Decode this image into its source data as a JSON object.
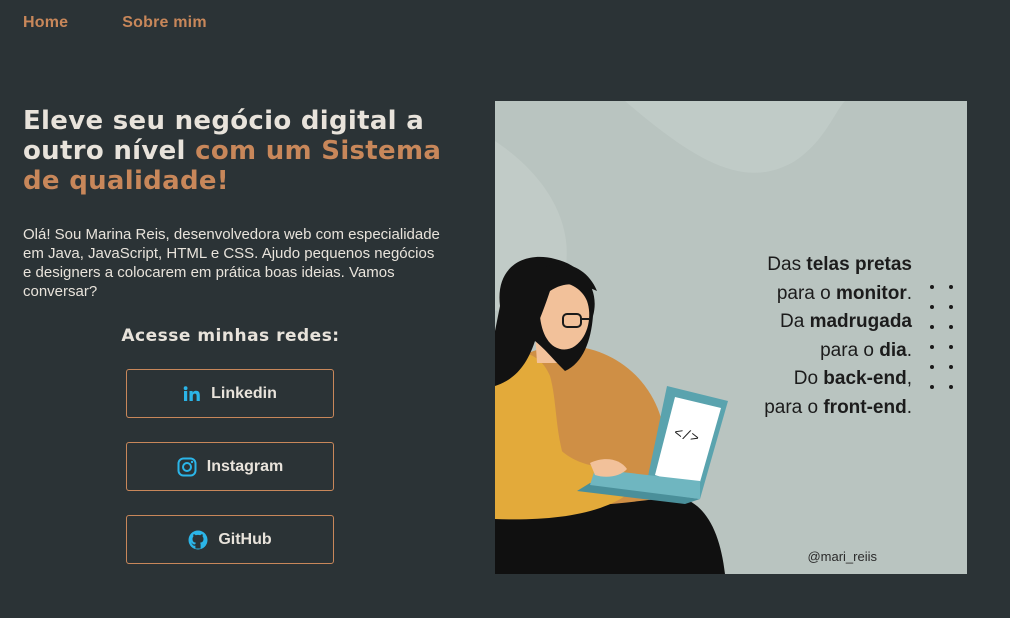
{
  "nav": {
    "home": "Home",
    "about": "Sobre mim"
  },
  "hero": {
    "title_part1": "Eleve seu negócio digital a outro nível",
    "title_part2": "com um Sistema de qualidade!",
    "intro": "Olá! Sou Marina Reis, desenvolvedora web com especialidade em Java, JavaScript, HTML e CSS. Ajudo pequenos negócios e designers a colocarem em prática boas ideias. Vamos conversar?"
  },
  "social": {
    "title": "Acesse minhas redes:",
    "linkedin": "Linkedin",
    "instagram": "Instagram",
    "github": "GitHub"
  },
  "illustration": {
    "lines": [
      {
        "pre": "Das ",
        "bold": "telas pretas",
        "post": ""
      },
      {
        "pre": "para o ",
        "bold": "monitor",
        "post": "."
      },
      {
        "pre": "Da ",
        "bold": "madrugada",
        "post": ""
      },
      {
        "pre": "para o ",
        "bold": "dia",
        "post": "."
      },
      {
        "pre": "Do ",
        "bold": "back-end",
        "post": ","
      },
      {
        "pre": "para o ",
        "bold": "front-end",
        "post": "."
      }
    ],
    "handle": "@mari_reiis",
    "code_glyph": "</>"
  },
  "colors": {
    "background": "#2b3336",
    "accent": "#c8875a",
    "text": "#e8e3db",
    "icon": "#2bb5e8",
    "art_bg": "#b9c4c0"
  }
}
